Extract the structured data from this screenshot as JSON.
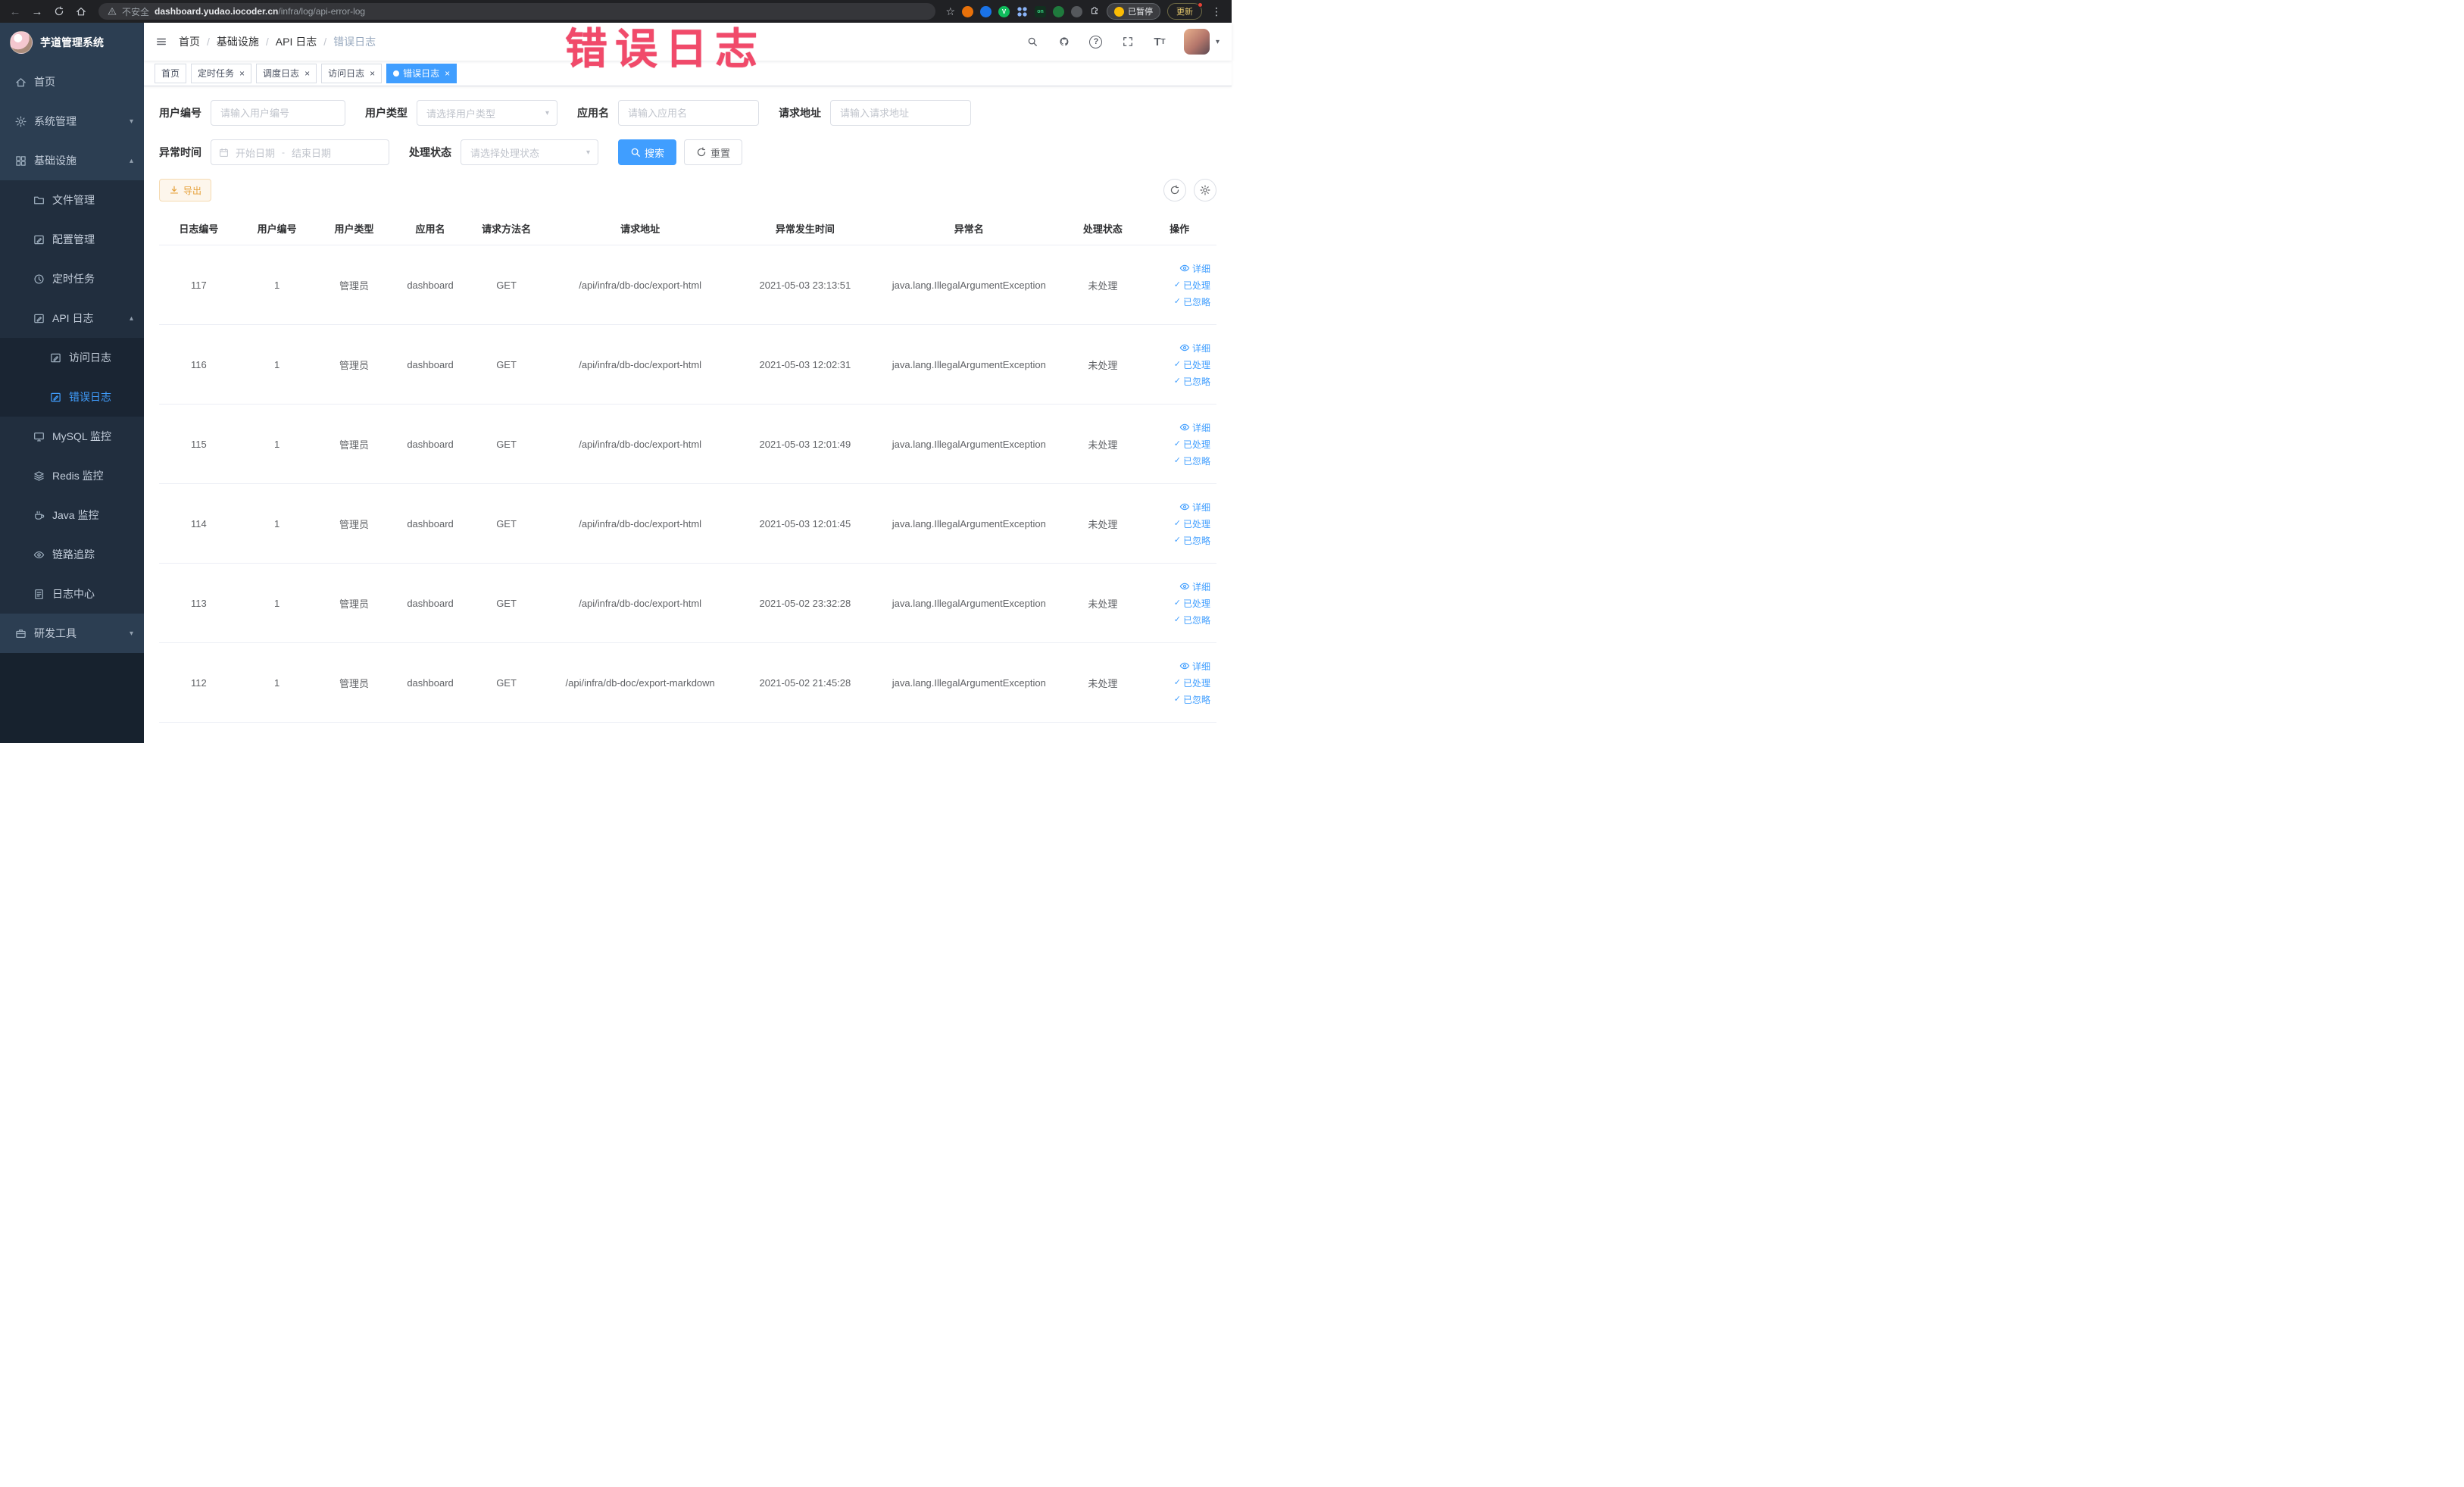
{
  "watermark": "错误日志",
  "browser": {
    "security_warning": "不安全",
    "url_host": "dashboard.yudao.iocoder.cn",
    "url_path": "/infra/log/api-error-log",
    "paused_label": "已暂停",
    "update_label": "更新"
  },
  "sidebar": {
    "logo_title": "芋道管理系统",
    "items": [
      {
        "id": "home",
        "label": "首页",
        "icon": "home-icon",
        "level": 1
      },
      {
        "id": "system-management",
        "label": "系统管理",
        "icon": "gear-icon",
        "level": 1,
        "expandable": true,
        "expanded": false
      },
      {
        "id": "infrastructure",
        "label": "基础设施",
        "icon": "infra-icon",
        "level": 1,
        "expandable": true,
        "expanded": true
      },
      {
        "id": "file-management",
        "label": "文件管理",
        "icon": "file-icon",
        "level": 2
      },
      {
        "id": "config-management",
        "label": "配置管理",
        "icon": "config-icon",
        "level": 2
      },
      {
        "id": "scheduled-jobs",
        "label": "定时任务",
        "icon": "job-icon",
        "level": 2
      },
      {
        "id": "api-logs",
        "label": "API 日志",
        "icon": "api-log-icon",
        "level": 2,
        "expandable": true,
        "expanded": true
      },
      {
        "id": "access-log",
        "label": "访问日志",
        "icon": "access-log-icon",
        "level": 3
      },
      {
        "id": "error-log",
        "label": "错误日志",
        "icon": "error-log-icon",
        "level": 3,
        "active": true
      },
      {
        "id": "mysql-monitor",
        "label": "MySQL 监控",
        "icon": "mysql-icon",
        "level": 2
      },
      {
        "id": "redis-monitor",
        "label": "Redis 监控",
        "icon": "redis-icon",
        "level": 2
      },
      {
        "id": "java-monitor",
        "label": "Java 监控",
        "icon": "java-icon",
        "level": 2
      },
      {
        "id": "link-trace",
        "label": "链路追踪",
        "icon": "trace-icon",
        "level": 2
      },
      {
        "id": "log-center",
        "label": "日志中心",
        "icon": "log-center-icon",
        "level": 2
      },
      {
        "id": "dev-tools",
        "label": "研发工具",
        "icon": "tools-icon",
        "level": 1,
        "expandable": true,
        "expanded": false
      }
    ]
  },
  "breadcrumb": [
    "首页",
    "基础设施",
    "API 日志",
    "错误日志"
  ],
  "tabs": [
    {
      "id": "home",
      "label": "首页",
      "closable": false,
      "active": false
    },
    {
      "id": "scheduled-jobs",
      "label": "定时任务",
      "closable": true,
      "active": false
    },
    {
      "id": "job-log",
      "label": "调度日志",
      "closable": true,
      "active": false
    },
    {
      "id": "access-log",
      "label": "访问日志",
      "closable": true,
      "active": false
    },
    {
      "id": "error-log",
      "label": "错误日志",
      "closable": true,
      "active": true
    }
  ],
  "filters": {
    "user_id": {
      "label": "用户编号",
      "placeholder": "请输入用户编号"
    },
    "user_type": {
      "label": "用户类型",
      "placeholder": "请选择用户类型"
    },
    "app_name": {
      "label": "应用名",
      "placeholder": "请输入应用名"
    },
    "request_url": {
      "label": "请求地址",
      "placeholder": "请输入请求地址"
    },
    "exception_time": {
      "label": "异常时间",
      "start_placeholder": "开始日期",
      "separator": "-",
      "end_placeholder": "结束日期"
    },
    "process_status": {
      "label": "处理状态",
      "placeholder": "请选择处理状态"
    },
    "search_label": "搜索",
    "reset_label": "重置"
  },
  "toolbar": {
    "export_label": "导出"
  },
  "table": {
    "columns": [
      "日志编号",
      "用户编号",
      "用户类型",
      "应用名",
      "请求方法名",
      "请求地址",
      "异常发生时间",
      "异常名",
      "处理状态",
      "操作"
    ],
    "actions": [
      "详细",
      "已处理",
      "已忽略"
    ],
    "rows": [
      {
        "id": "117",
        "user_id": "1",
        "user_type": "管理员",
        "app": "dashboard",
        "method": "GET",
        "url": "/api/infra/db-doc/export-html",
        "time": "2021-05-03 23:13:51",
        "exception": "java.lang.IllegalArgumentException",
        "status": "未处理"
      },
      {
        "id": "116",
        "user_id": "1",
        "user_type": "管理员",
        "app": "dashboard",
        "method": "GET",
        "url": "/api/infra/db-doc/export-html",
        "time": "2021-05-03 12:02:31",
        "exception": "java.lang.IllegalArgumentException",
        "status": "未处理"
      },
      {
        "id": "115",
        "user_id": "1",
        "user_type": "管理员",
        "app": "dashboard",
        "method": "GET",
        "url": "/api/infra/db-doc/export-html",
        "time": "2021-05-03 12:01:49",
        "exception": "java.lang.IllegalArgumentException",
        "status": "未处理"
      },
      {
        "id": "114",
        "user_id": "1",
        "user_type": "管理员",
        "app": "dashboard",
        "method": "GET",
        "url": "/api/infra/db-doc/export-html",
        "time": "2021-05-03 12:01:45",
        "exception": "java.lang.IllegalArgumentException",
        "status": "未处理"
      },
      {
        "id": "113",
        "user_id": "1",
        "user_type": "管理员",
        "app": "dashboard",
        "method": "GET",
        "url": "/api/infra/db-doc/export-html",
        "time": "2021-05-02 23:32:28",
        "exception": "java.lang.IllegalArgumentException",
        "status": "未处理"
      },
      {
        "id": "112",
        "user_id": "1",
        "user_type": "管理员",
        "app": "dashboard",
        "method": "GET",
        "url": "/api/infra/db-doc/export-markdown",
        "time": "2021-05-02 21:45:28",
        "exception": "java.lang.IllegalArgumentException",
        "status": "未处理"
      }
    ]
  }
}
